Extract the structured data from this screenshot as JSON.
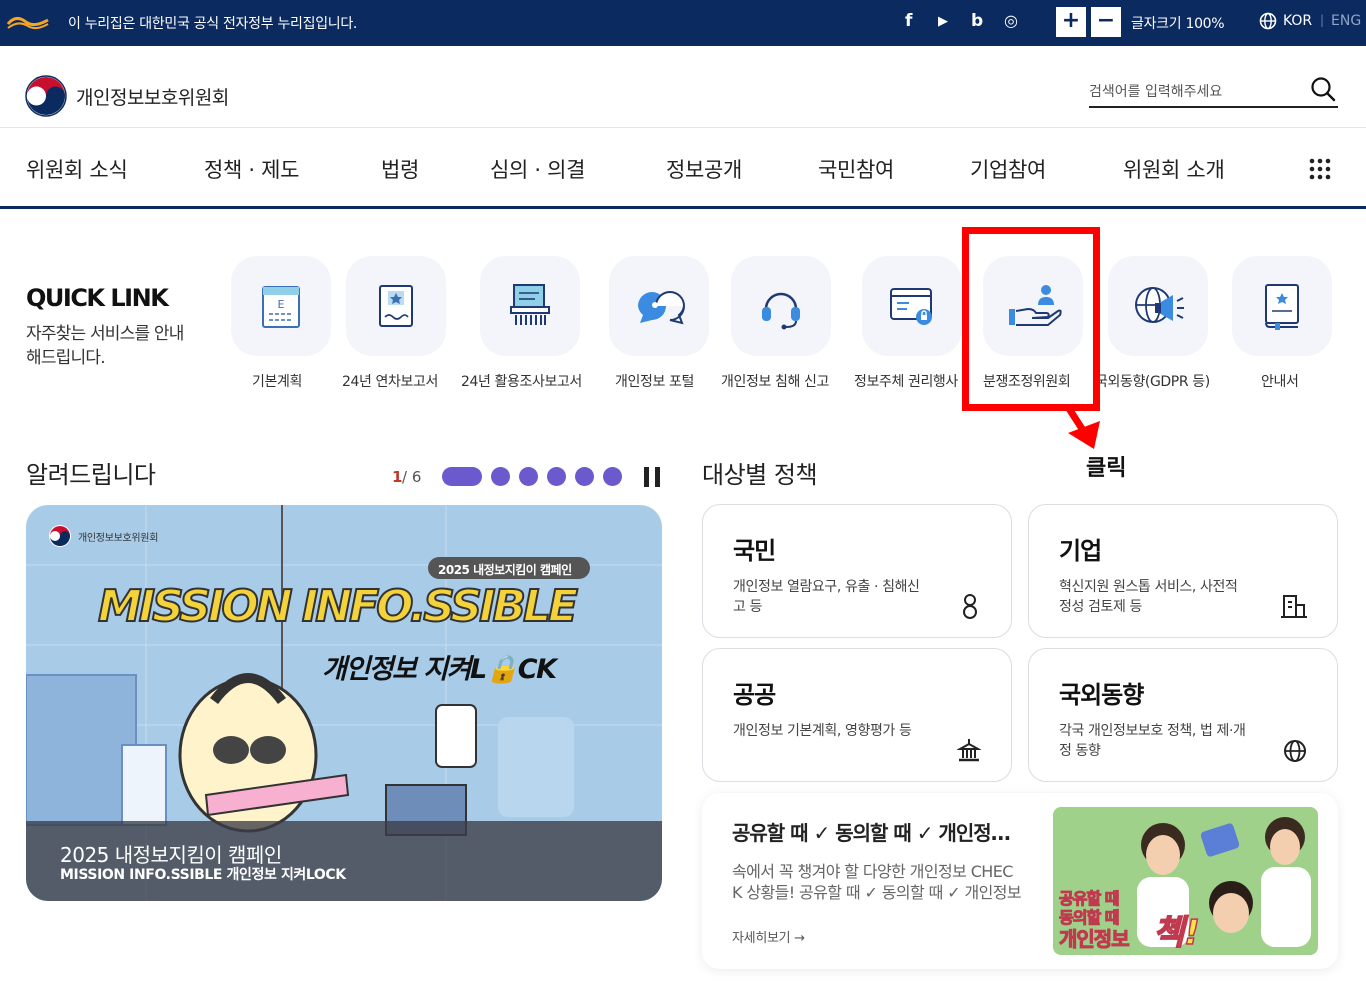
{
  "topbar": {
    "notice": "이 누리집은 대한민국 공식 전자정부 누리집입니다.",
    "social": [
      "f",
      "▶",
      "b",
      "◎"
    ],
    "font_plus": "+",
    "font_minus": "−",
    "font_size_label": "글자크기 100%",
    "lang_kor": "KOR",
    "lang_sep": "|",
    "lang_eng": "ENG"
  },
  "header": {
    "org_name": "개인정보보호위원회",
    "search_placeholder": "검색어를 입력해주세요"
  },
  "gnb": [
    "위원회 소식",
    "정책 · 제도",
    "법령",
    "심의 · 의결",
    "정보공개",
    "국민참여",
    "기업참여",
    "위원회 소개"
  ],
  "quicklink": {
    "title": "QUICK LINK",
    "desc": "자주찾는 서비스를 안내해드립니다.",
    "items": [
      {
        "label": "기본계획",
        "icon": "plan-document-icon"
      },
      {
        "label": "24년 연차보고서",
        "icon": "annual-report-icon"
      },
      {
        "label": "24년 활용조사보고서",
        "icon": "survey-report-icon"
      },
      {
        "label": "개인정보 포털",
        "icon": "portal-chat-icon"
      },
      {
        "label": "개인정보 침해 신고",
        "icon": "headset-icon"
      },
      {
        "label": "정보주체 권리행사",
        "icon": "rights-lock-icon"
      },
      {
        "label": "분쟁조정위원회",
        "icon": "mediation-hand-icon"
      },
      {
        "label": "국외동향(GDPR 등)",
        "icon": "global-megaphone-icon"
      },
      {
        "label": "안내서",
        "icon": "guidebook-icon"
      }
    ]
  },
  "annotation": {
    "click_label": "클릭",
    "color": "#ff0000"
  },
  "notice": {
    "title": "알려드립니다",
    "pager_current": "1",
    "pager_total": "/ 6",
    "banner": {
      "org": "개인정보보호위원회",
      "badge": "2025 내정보지킴이 캠페인",
      "headline": "MISSION INFO.SSIBLE",
      "subline": "개인정보 지켜L🔒CK",
      "caption_title": "2025 내정보지킴이 캠페인",
      "caption_sub": "MISSION INFO.SSIBLE 개인정보 지켜LOCK"
    }
  },
  "policy": {
    "title": "대상별 정책",
    "cards": [
      {
        "title": "국민",
        "desc": "개인정보 열람요구, 유출 · 침해신고 등",
        "icon": "person-icon"
      },
      {
        "title": "기업",
        "desc": "혁신지원 원스톱 서비스, 사전적정성 검토제 등",
        "icon": "building-icon"
      },
      {
        "title": "공공",
        "desc": "개인정보 기본계획, 영향평가 등",
        "icon": "government-icon"
      },
      {
        "title": "국외동향",
        "desc": "각국 개인정보보호 정책, 법 제·개정 동향",
        "icon": "globe-icon"
      }
    ]
  },
  "promo": {
    "title": "공유할 때 ✓ 동의할 때 ✓ 개인정보 CHECK",
    "desc": "속에서 꼭 챙겨야 할 다양한 개인정보 CHECK 상황들! 공유할 때 ✓ 동의할 때 ✓ 개인정보 CHECK",
    "more": "자세히보기 →",
    "img_text1": "공유할 때",
    "img_text2": "동의할 때",
    "img_text3": "개인정보",
    "img_text4": "첵!"
  },
  "colors": {
    "navy": "#0b2a5f",
    "accent": "#6a5acd",
    "highlight": "#ff0000"
  }
}
